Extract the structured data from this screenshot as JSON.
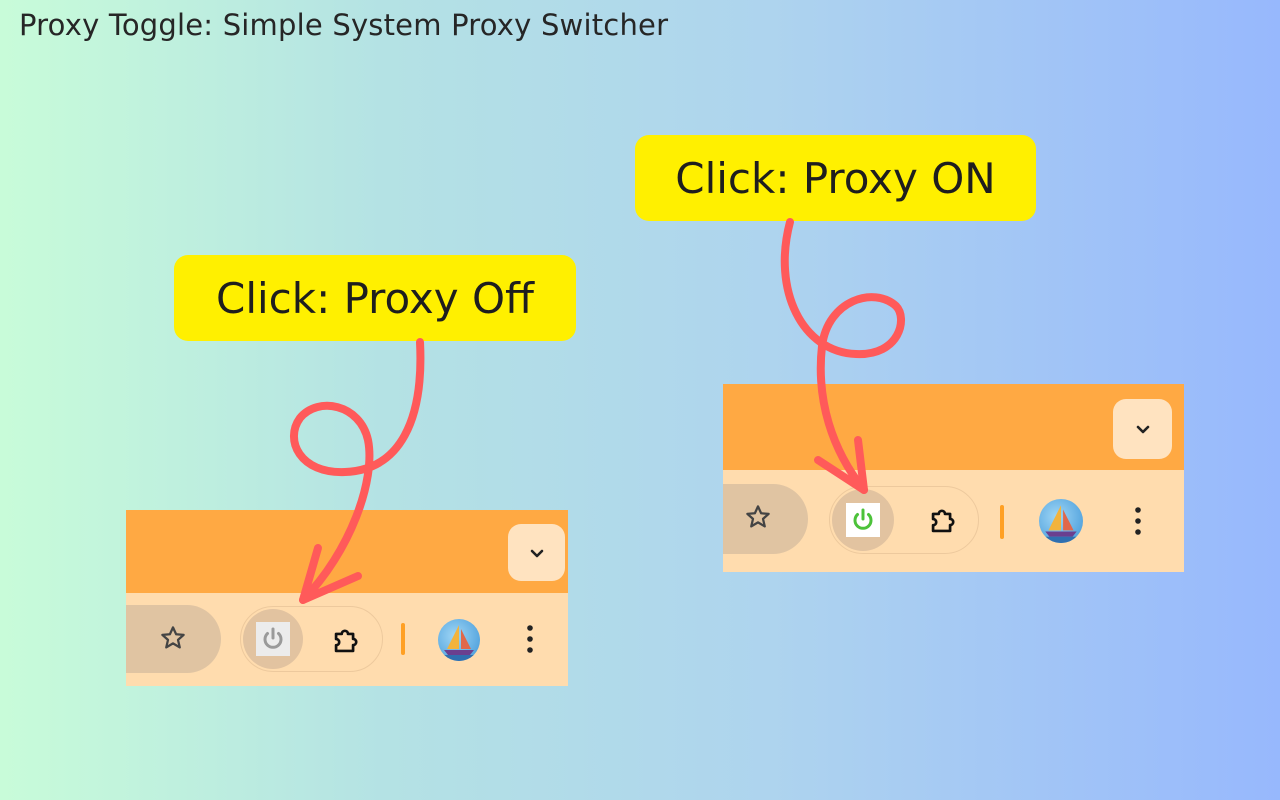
{
  "page": {
    "title": "Proxy Toggle: Simple System Proxy Switcher"
  },
  "callouts": {
    "off": "Click: Proxy Off",
    "on": "Click: Proxy ON"
  },
  "colors": {
    "callout_bg": "#fff000",
    "tabstrip": "#ffa943",
    "toolbar": "#ffdcae",
    "arrow": "#ff5a5a",
    "power_off": "#9a9a9a",
    "power_on": "#4cc23a"
  },
  "browsers": [
    {
      "state": "off",
      "icons": [
        "chevron-down-icon",
        "star-icon",
        "power-icon",
        "puzzle-icon",
        "avatar",
        "kebab-menu-icon"
      ]
    },
    {
      "state": "on",
      "icons": [
        "chevron-down-icon",
        "star-icon",
        "power-icon",
        "puzzle-icon",
        "avatar",
        "kebab-menu-icon"
      ]
    }
  ]
}
